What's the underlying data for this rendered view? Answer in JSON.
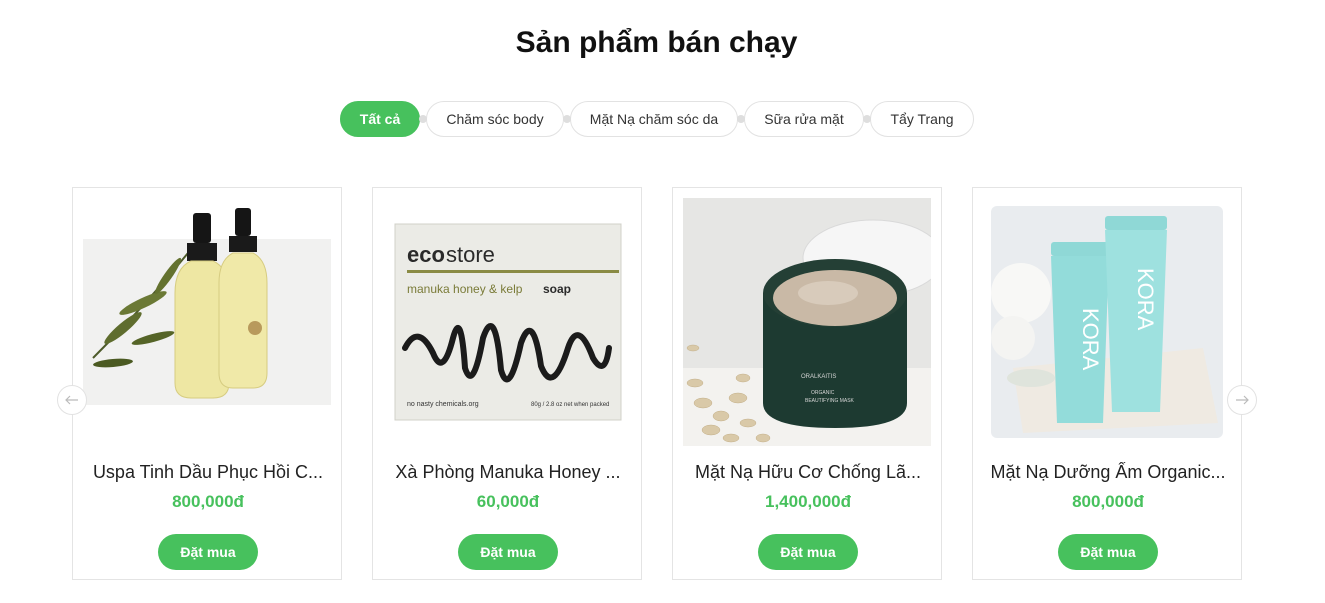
{
  "section": {
    "title": "Sản phẩm bán chạy"
  },
  "tabs": [
    {
      "label": "Tất cả",
      "active": true
    },
    {
      "label": "Chăm sóc body",
      "active": false
    },
    {
      "label": "Mặt Nạ chăm sóc da",
      "active": false
    },
    {
      "label": "Sữa rửa mặt",
      "active": false
    },
    {
      "label": "Tẩy Trang",
      "active": false
    }
  ],
  "products": [
    {
      "name": "Uspa Tinh Dầu Phục Hồi C...",
      "price": "800,000đ",
      "button": "Đặt mua",
      "image": "oil-bottles-image"
    },
    {
      "name": "Xà Phòng Manuka Honey ...",
      "price": "60,000đ",
      "button": "Đặt mua",
      "image": "soap-box-image",
      "pack": {
        "brand_left": "eco",
        "brand_right": "store",
        "subtitle_a": "manuka honey & kelp ",
        "subtitle_b": "soap",
        "footer_left": "no nasty chemicals.org",
        "footer_right": "80g / 2.8 oz  net when packed"
      }
    },
    {
      "name": "Mặt Nạ Hữu Cơ Chống Lã...",
      "price": "1,400,000đ",
      "button": "Đặt mua",
      "image": "mask-jar-image",
      "jar": {
        "brand": "ORALKAITIS",
        "line1": "ORGANIC",
        "line2": "BEAUTIFYING MASK"
      }
    },
    {
      "name": "Mặt Nạ Dưỡng Ẩm Organic...",
      "price": "800,000đ",
      "button": "Đặt mua",
      "image": "kora-tubes-image",
      "tube": {
        "brand": "KORA"
      }
    }
  ],
  "carousel": {
    "prev_icon": "arrow-left-icon",
    "next_icon": "arrow-right-icon"
  },
  "colors": {
    "accent": "#47c15d",
    "border": "#e4e4e4"
  }
}
